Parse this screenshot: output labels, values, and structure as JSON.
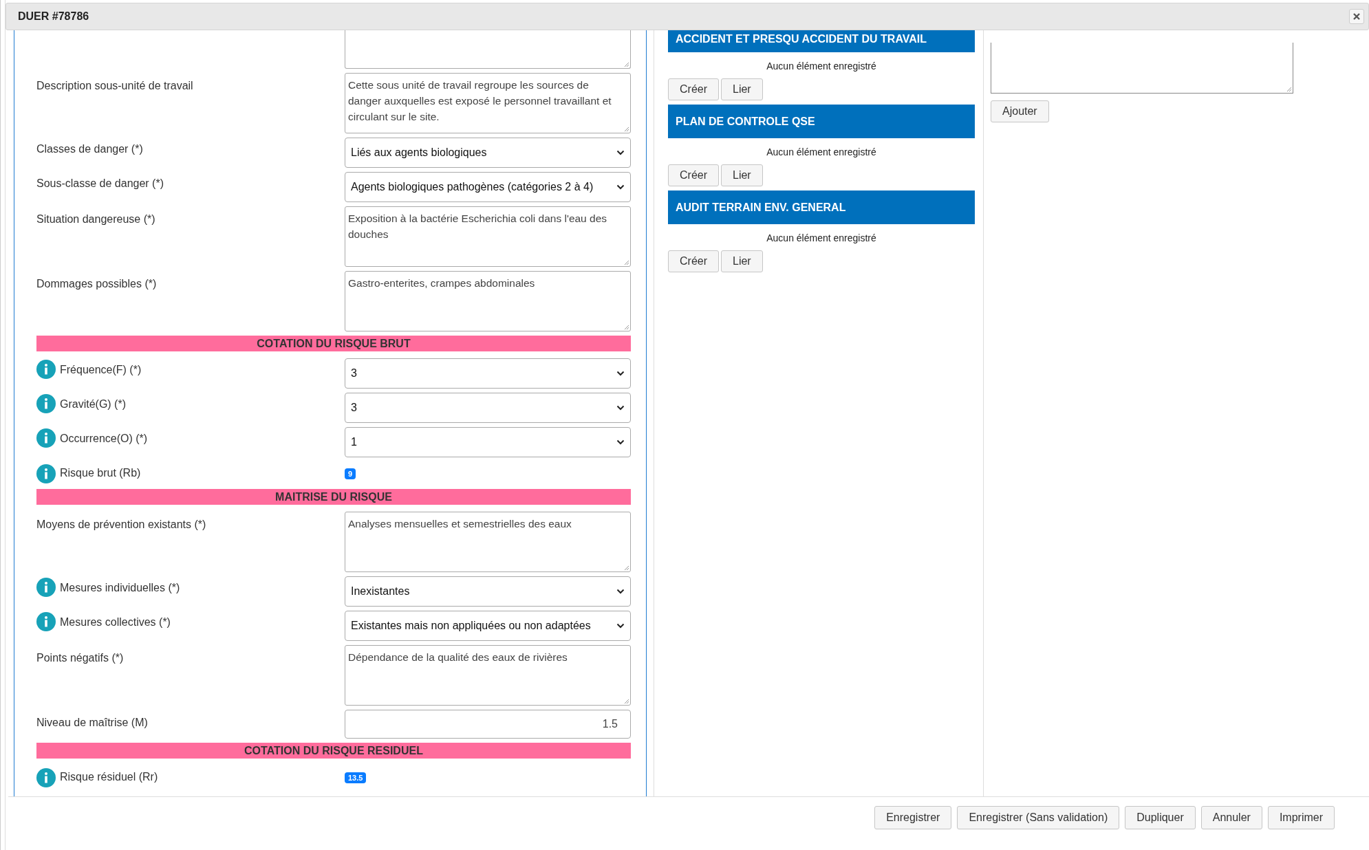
{
  "window": {
    "title": "DUER #78786"
  },
  "form": [
    {
      "kind": "textarea"
    },
    {
      "kind": "textarea",
      "label": "Description sous-unité de travail",
      "value": "Cette sous unité de travail regroupe les sources de danger auxquelles est exposé  le personnel travaillant et circulant sur le site."
    },
    {
      "kind": "select",
      "label": "Classes de danger (*)",
      "value": "Liés aux agents biologiques"
    },
    {
      "kind": "select",
      "label": "Sous-classe de danger (*)",
      "value": "Agents biologiques pathogènes (catégories 2 à 4)"
    },
    {
      "kind": "textarea",
      "label": "Situation dangereuse (*)",
      "value": "Exposition à la bactérie Escherichia coli dans l'eau des douches"
    },
    {
      "kind": "textarea",
      "label": "Dommages possibles (*)",
      "value": "Gastro-enterites, crampes abdominales"
    },
    {
      "kind": "section",
      "label": "COTATION DU RISQUE BRUT"
    },
    {
      "kind": "select",
      "label": "Fréquence(F) (*)",
      "value": "3",
      "info": true
    },
    {
      "kind": "select",
      "label": "Gravité(G) (*)",
      "value": "3",
      "info": true
    },
    {
      "kind": "select",
      "label": "Occurrence(O) (*)",
      "value": "1",
      "info": true
    },
    {
      "kind": "badge",
      "label": "Risque brut (Rb)",
      "value": "9",
      "info": true
    },
    {
      "kind": "section",
      "label": "MAITRISE DU RISQUE"
    },
    {
      "kind": "textarea",
      "label": "Moyens de prévention existants (*)",
      "value": "Analyses mensuelles et semestrielles des eaux"
    },
    {
      "kind": "select",
      "label": "Mesures individuelles (*)",
      "value": "Inexistantes",
      "info": true
    },
    {
      "kind": "select",
      "label": "Mesures collectives (*)",
      "value": "Existantes mais non appliquées ou non adaptées",
      "info": true
    },
    {
      "kind": "textarea",
      "label": "Points négatifs (*)",
      "value": "Dépendance de la qualité des eaux de rivières"
    },
    {
      "kind": "input",
      "label": "Niveau de maîtrise (M)",
      "value": "1.5"
    },
    {
      "kind": "section",
      "label": "COTATION DU RISQUE RESIDUEL"
    },
    {
      "kind": "badge",
      "label": "Risque résiduel (Rr)",
      "value": "13.5",
      "info": true
    }
  ],
  "linked_sections": [
    {
      "title": "ACCIDENT ET PRESQU ACCIDENT DU TRAVAIL",
      "empty_text": "Aucun élément enregistré",
      "buttons": [
        "Créer",
        "Lier"
      ]
    },
    {
      "title": "PLAN DE CONTROLE QSE",
      "empty_text": "Aucun élément enregistré",
      "buttons": [
        "Créer",
        "Lier"
      ]
    },
    {
      "title": "AUDIT TERRAIN ENV. GENERAL",
      "empty_text": "Aucun élément enregistré",
      "buttons": [
        "Créer",
        "Lier"
      ]
    }
  ],
  "comment": {
    "button": "Ajouter"
  },
  "footer_buttons": [
    "Enregistrer",
    "Enregistrer (Sans validation)",
    "Dupliquer",
    "Annuler",
    "Imprimer"
  ]
}
